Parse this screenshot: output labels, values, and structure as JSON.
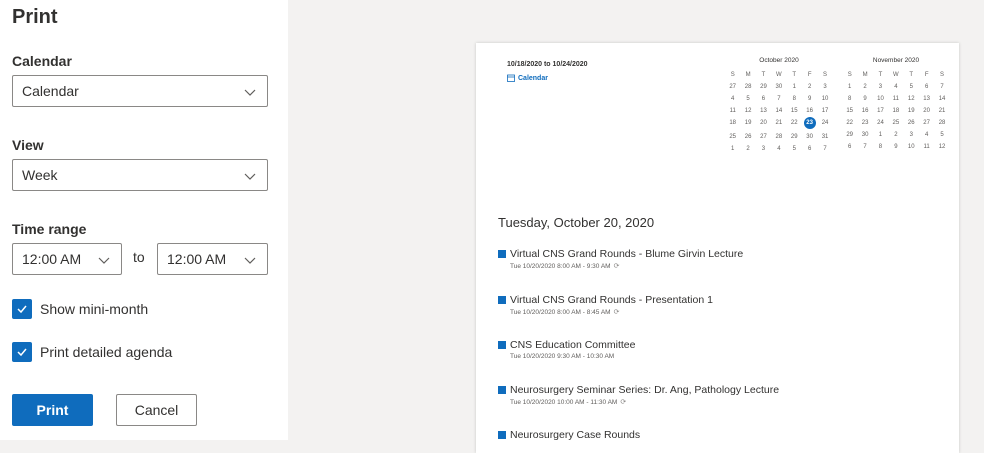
{
  "dialog": {
    "title": "Print",
    "calendar_label": "Calendar",
    "calendar_value": "Calendar",
    "view_label": "View",
    "view_value": "Week",
    "time_range_label": "Time range",
    "time_from": "12:00 AM",
    "to_label": "to",
    "time_to": "12:00 AM",
    "show_mini_month": "Show mini-month",
    "print_detailed_agenda": "Print detailed agenda",
    "print_button": "Print",
    "cancel_button": "Cancel"
  },
  "preview": {
    "date_range": "10/18/2020 to 10/24/2020",
    "calendar_link": "Calendar",
    "october": {
      "title": "October 2020",
      "weekdays": [
        "S",
        "M",
        "T",
        "W",
        "T",
        "F",
        "S"
      ],
      "days": [
        "27",
        "28",
        "29",
        "30",
        "1",
        "2",
        "3",
        "4",
        "5",
        "6",
        "7",
        "8",
        "9",
        "10",
        "11",
        "12",
        "13",
        "14",
        "15",
        "16",
        "17",
        "18",
        "19",
        "20",
        "21",
        "22",
        "23",
        "24",
        "25",
        "26",
        "27",
        "28",
        "29",
        "30",
        "31",
        "1",
        "2",
        "3",
        "4",
        "5",
        "6",
        "7"
      ],
      "selected": "23"
    },
    "november": {
      "title": "November 2020",
      "weekdays": [
        "S",
        "M",
        "T",
        "W",
        "T",
        "F",
        "S"
      ],
      "days": [
        "1",
        "2",
        "3",
        "4",
        "5",
        "6",
        "7",
        "8",
        "9",
        "10",
        "11",
        "12",
        "13",
        "14",
        "15",
        "16",
        "17",
        "18",
        "19",
        "20",
        "21",
        "22",
        "23",
        "24",
        "25",
        "26",
        "27",
        "28",
        "29",
        "30",
        "1",
        "2",
        "3",
        "4",
        "5",
        "6",
        "7",
        "8",
        "9",
        "10",
        "11",
        "12"
      ]
    },
    "day_heading": "Tuesday, October 20, 2020",
    "events": [
      {
        "title": "Virtual CNS Grand Rounds - Blume Girvin Lecture",
        "time": "Tue 10/20/2020 8:00 AM - 9:30 AM",
        "recurring": true
      },
      {
        "title": "Virtual CNS Grand Rounds - Presentation 1",
        "time": "Tue 10/20/2020 8:00 AM - 8:45 AM",
        "recurring": true
      },
      {
        "title": "CNS Education Committee",
        "time": "Tue 10/20/2020 9:30 AM - 10:30 AM",
        "recurring": false
      },
      {
        "title": "Neurosurgery Seminar Series: Dr. Ang, Pathology Lecture",
        "time": "Tue 10/20/2020 10:00 AM - 11:30 AM",
        "recurring": true
      },
      {
        "title": "Neurosurgery Case Rounds",
        "time": "",
        "recurring": false
      }
    ]
  },
  "colors": {
    "accent": "#0f6cbd",
    "panel_bg": "#f3f2f1"
  }
}
